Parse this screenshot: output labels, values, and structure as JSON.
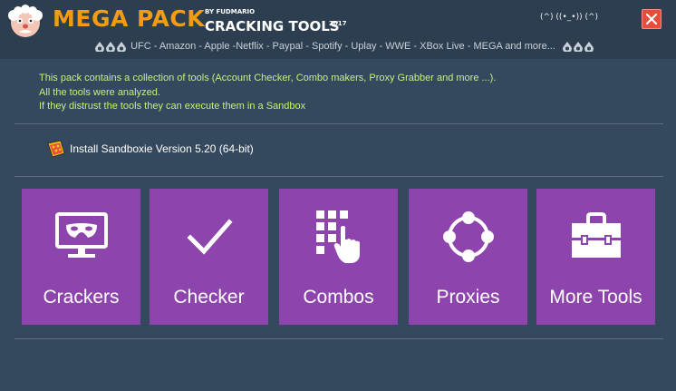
{
  "header": {
    "title": "MEGA PACK",
    "by_line": "BY FUDMARIO",
    "subtitle": "CRACKING TOOLS",
    "year": "2017",
    "emote_left": "(^) ((•_•)) (^)",
    "close_icon": "close-icon",
    "services_text": "UFC - Amazon - Apple -Netflix - Paypal - Spotify - Uplay - WWE - XBox Live - MEGA and more..."
  },
  "info": {
    "line1": "This pack contains a collection of tools (Account Checker, Combo makers, Proxy Grabber and more ...).",
    "line2": "All the tools were analyzed.",
    "line3": "If they distrust the tools they can execute them in a Sandbox"
  },
  "sandbox": {
    "label": "Install Sandboxie Version 5.20 (64-bit)",
    "icon": "sandboxie-icon"
  },
  "tiles": [
    {
      "label": "Crackers",
      "icon": "mask-monitor-icon"
    },
    {
      "label": "Checker",
      "icon": "checkmark-icon"
    },
    {
      "label": "Combos",
      "icon": "keypad-touch-icon"
    },
    {
      "label": "Proxies",
      "icon": "network-circle-icon"
    },
    {
      "label": "More Tools",
      "icon": "toolbox-icon"
    }
  ],
  "colors": {
    "background": "#34495e",
    "titlebar": "#2c3e50",
    "tile": "#8e44ad",
    "title_accent": "#f39c12",
    "info_text": "#c7f07a",
    "close": "#e74c3c"
  }
}
